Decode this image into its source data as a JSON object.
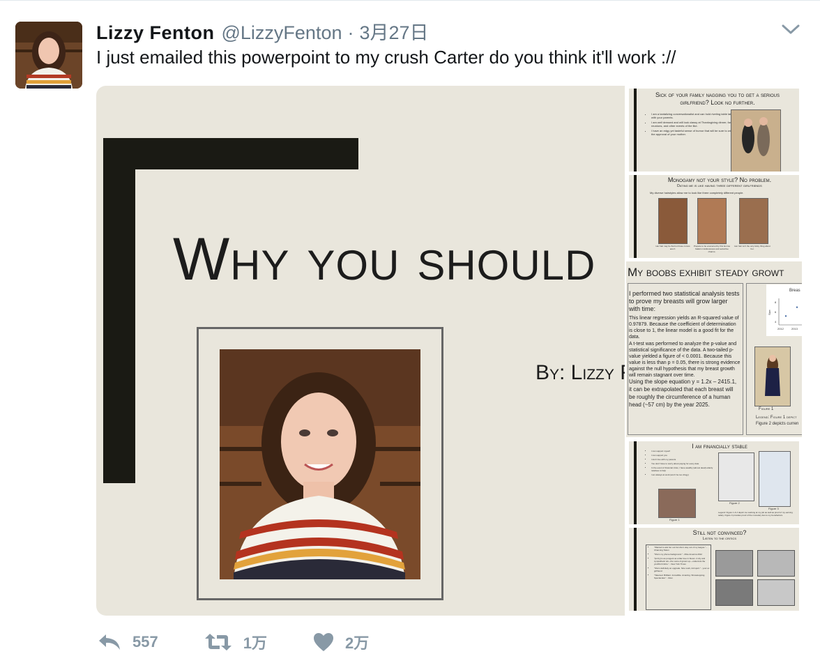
{
  "tweet": {
    "name": "Lizzy Fenton",
    "handle": "@LizzyFenton",
    "separator": "·",
    "date": "3月27日",
    "text": "I just emailed this powerpoint to my crush Carter do you think it'll work ://"
  },
  "slides": {
    "main": {
      "title": "Why you should",
      "byline": "By: Lizzy F"
    },
    "s1": {
      "title": "Sick of your family nagging you to get a serious girlfriend? Look no further.",
      "bullets": [
        "I am a tantalizing conversationalist and can hold riveting table talk with your parents.",
        "I am well dressed and will look classy at Thanksgiving dinner, family reunions, and other events of the like.",
        "I have an edgy yet tasteful sense of humor that will be sure to win the approval of your mother."
      ]
    },
    "s2": {
      "title": "Monogamy not your style? No problem.",
      "subtitle": "Dating me is like having three different girlfriends",
      "bullet": "My diverse hairstyles allow me to look like three completely different people.",
      "captions": [
        "Her hair may be flat but those curves aren't.",
        "Prepare to be enamored by this femme fatale's insidiousness and seductive charms.",
        "Her hair isn't the only kinky thing about her."
      ]
    },
    "s3": {
      "title": "My boobs exhibit steady growt",
      "para1": "I performed two statistical analysis tests to prove my breasts will grow larger with time:",
      "para2": "This linear regression yields an R-squared value of 0.97879. Because the coefficient of determination is close to 1, the linear model is a good fit for the data.",
      "para3": "A t-test was performed to analyze the p-value and statistical significance of the data. A two-tailed p-value yielded a figure of < 0.0001. Because this value is less than p = 0.05, there is strong evidence against the null hypothesis that my breast growth will remain stagnant over time.",
      "para4": "Using the slope equation y = 1.2x – 2415.1, it can be extrapolated that each breast will be roughly the circumference of a human head (~57 cm) by the year 2025.",
      "chart_title": "Breas",
      "figure": "Figure 1",
      "legend1": "Legend: Figure 1 depict",
      "legend2": "Figure 2 depicts curren"
    },
    "s4": {
      "title": "I am financially stable",
      "bullets": [
        "I can support myself",
        "I can support you",
        "I don't live with my parents",
        "You don't have to worry about paying for every date",
        "In the event of financial crisis, I have wealthy (almost dead) elderly relatives to help",
        "I am always at work (won't be too clingy)"
      ],
      "fig1": "Figure 1",
      "fig2": "Figure 2",
      "fig3": "Figure 3",
      "note": "Legend: Figure 1 & 2 depict me working at my job as well as proof of my earning salary. Figure 3 provides proof of the monetary ties to my benefactors."
    },
    "s5": {
      "title": "Still not convinced?",
      "subtitle": "Listen to the critics",
      "quotes": [
        "\"Wanted to ask her out but she's way out of my league.\" - Channing Tatum",
        "\"She's my phone background.\" - Miss America 2012",
        "\"[Lizzy] is as pungent as a lilac tree in bloom. A dry and sympathetic wit—the voice of grown up—undercuts the youthful timbre.\" - New York Times",
        "\"She's definitely an upgrade. Nice work, kid sport.\" - your ex girlfriend",
        "\"Talented. Brilliant. Incredible. Amazing. Showstopping. Spectacular.\" - Mom"
      ]
    }
  },
  "chart_data": {
    "type": "scatter",
    "title": "Breas",
    "xlabel": "",
    "ylabel": "Size",
    "x": [
      "2012",
      "2013"
    ],
    "yticks": [
      "8",
      "6",
      "4"
    ],
    "values": [
      5,
      7
    ]
  },
  "actions": {
    "reply_count": "557",
    "retweet_count": "1万",
    "like_count": "2万"
  },
  "colors": {
    "slide_bg": "#e9e6dc",
    "accent_bar": "#1a1a14",
    "muted": "#657786",
    "action": "#8899a6"
  },
  "icons": [
    "chevron-down-icon",
    "reply-icon",
    "retweet-icon",
    "heart-icon"
  ]
}
